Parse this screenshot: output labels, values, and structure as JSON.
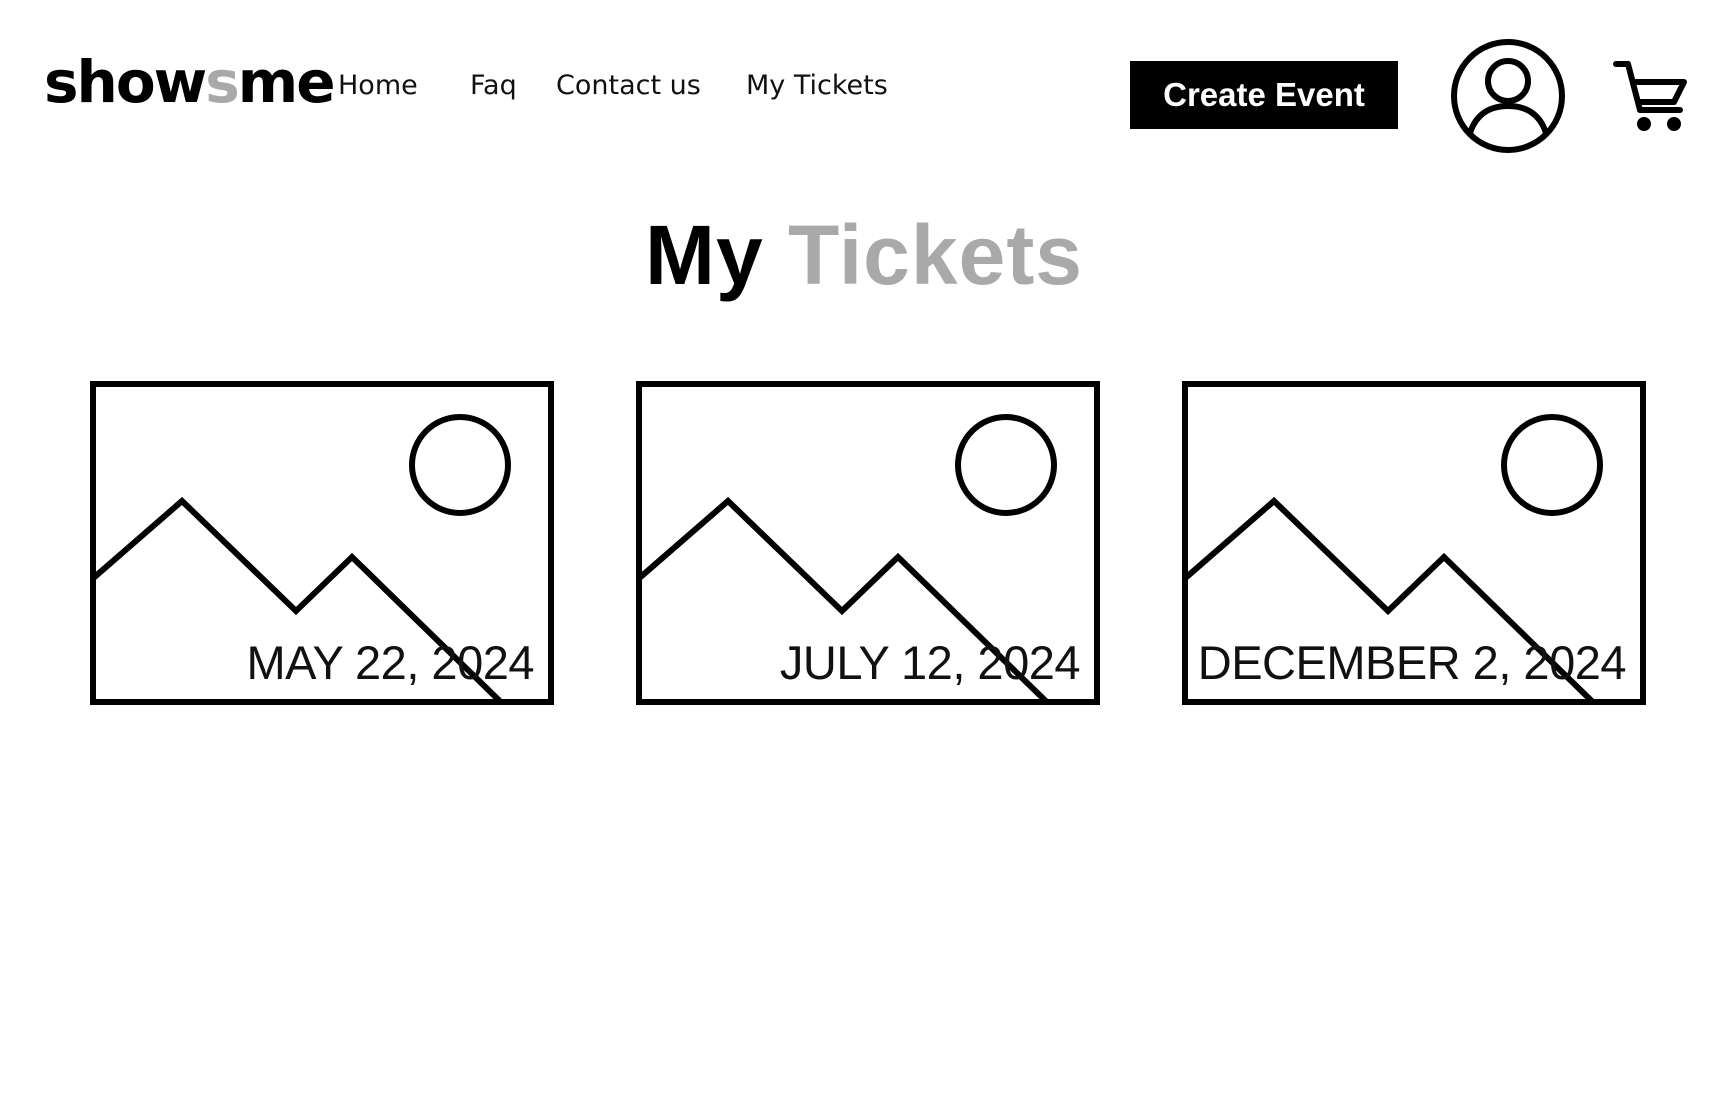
{
  "header": {
    "logo": {
      "part1": "show",
      "part2": "s",
      "part3": "me"
    },
    "nav": [
      {
        "label": "Home"
      },
      {
        "label": "Faq"
      },
      {
        "label": "Contact us"
      },
      {
        "label": "My Tickets"
      }
    ],
    "create_event_label": "Create Event",
    "icons": [
      "user-icon",
      "cart-icon"
    ]
  },
  "main": {
    "title": {
      "part1": "My",
      "part2": "Tickets"
    },
    "title_accent_color": "#a9a9a9",
    "tickets": [
      {
        "date": "MAY 22, 2024",
        "image_icon": "image-placeholder-icon"
      },
      {
        "date": "JULY 12, 2024",
        "image_icon": "image-placeholder-icon"
      },
      {
        "date": "DECEMBER 2, 2024",
        "image_icon": "image-placeholder-icon"
      }
    ]
  }
}
